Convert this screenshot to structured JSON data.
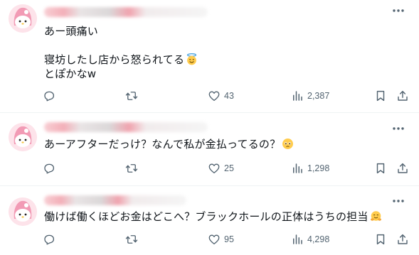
{
  "posts": [
    {
      "text": "あー頭痛い\n\n寝坊したし店から怒られてる",
      "text_line3": "とぽかなw",
      "emoji": "halo-emoji",
      "replies": "",
      "reposts": "",
      "likes": "43",
      "views": "2,387"
    },
    {
      "text": "あーアフターだっけ？なんで私が金払ってるの？",
      "emoji": "pleading-emoji",
      "replies": "",
      "reposts": "",
      "likes": "25",
      "views": "1,298"
    },
    {
      "text": "働けば働くほどお金はどこへ？ブラックホールの正体はうちの担当",
      "emoji": "hugging-emoji",
      "replies": "",
      "reposts": "",
      "likes": "95",
      "views": "4,298"
    }
  ],
  "icons": {
    "reply": "reply-icon",
    "repost": "repost-icon",
    "like": "heart-icon",
    "views": "views-icon",
    "bookmark": "bookmark-icon",
    "share": "share-icon",
    "more": "more-icon"
  },
  "colors": {
    "icon_gray": "#536471",
    "text": "#0f1419",
    "divider": "#eff3f4",
    "avatar_pink": "#f29bb5"
  }
}
